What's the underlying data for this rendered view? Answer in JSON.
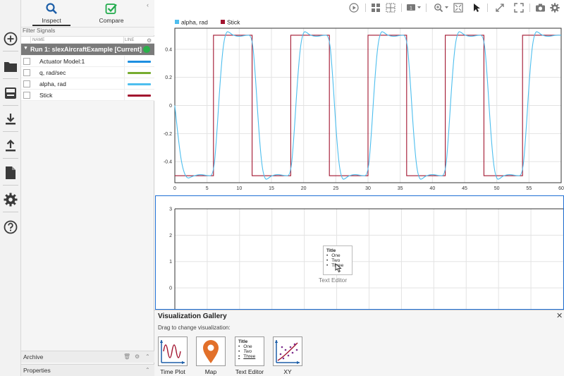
{
  "tabs": {
    "inspect": "Inspect",
    "compare": "Compare"
  },
  "filter_placeholder": "Filter Signals",
  "table_header": {
    "name": "NAME",
    "line": "LINE"
  },
  "run": {
    "label": "Run 1: slexAircraftExample [Current]"
  },
  "signals": [
    {
      "label": "Actuator Model:1",
      "color": "#1e8fe0"
    },
    {
      "label": "q, rad/sec",
      "color": "#77ac30"
    },
    {
      "label": "alpha, rad",
      "color": "#4dbeee"
    },
    {
      "label": "Stick",
      "color": "#a2142f"
    }
  ],
  "archive_label": "Archive",
  "properties_label": "Properties",
  "legend": [
    {
      "label": "alpha, rad",
      "color": "#4dbeee"
    },
    {
      "label": "Stick",
      "color": "#a2142f"
    }
  ],
  "icons": {
    "left_toolbar": [
      "new-icon",
      "open-folder-icon",
      "save-icon",
      "import-icon",
      "export-icon",
      "report-icon",
      "settings-icon",
      "help-icon"
    ],
    "top_toolbar": [
      "play-icon",
      "layout-icon",
      "subplot-icon",
      "zoom-icon",
      "fit-icon",
      "cursor-icon",
      "expand-icon",
      "fullscreen-icon",
      "camera-icon",
      "gear-icon"
    ]
  },
  "layout_badge": "1",
  "chart_data": [
    {
      "type": "line",
      "x_ticks": [
        "0",
        "5",
        "10",
        "15",
        "20",
        "25",
        "30",
        "35",
        "40",
        "45",
        "50",
        "55",
        "60"
      ],
      "y_ticks": [
        "-0.4",
        "-0.2",
        "0",
        "0.2",
        "0.4"
      ],
      "xlim": [
        0,
        60
      ],
      "ylim": [
        -0.55,
        0.55
      ],
      "grid": true,
      "legend_position": "top-left",
      "series": [
        {
          "name": "Stick",
          "color": "#a2142f",
          "x": [
            0,
            6,
            6,
            12,
            12,
            18,
            18,
            24,
            24,
            30,
            30,
            36,
            36,
            42,
            42,
            48,
            48,
            54,
            54,
            60
          ],
          "y": [
            -0.5,
            -0.5,
            0.5,
            0.5,
            -0.5,
            -0.5,
            0.5,
            0.5,
            -0.5,
            -0.5,
            0.5,
            0.5,
            -0.5,
            -0.5,
            0.5,
            0.5,
            -0.5,
            -0.5,
            0.5,
            0.5
          ]
        },
        {
          "name": "alpha, rad",
          "color": "#4dbeee",
          "x": [
            0,
            0.5,
            1,
            1.5,
            2,
            2.5,
            3,
            4,
            5,
            6,
            6.5,
            7,
            7.5,
            8,
            8.5,
            9,
            10,
            11,
            12,
            12.5,
            13,
            13.5,
            14,
            14.5,
            15,
            16,
            17,
            18,
            18.5,
            19,
            19.5,
            20,
            20.5,
            21,
            22,
            23,
            24,
            24.5,
            25,
            25.5,
            26,
            26.5,
            27,
            28,
            29,
            30,
            30.5,
            31,
            31.5,
            32,
            32.5,
            33,
            34,
            35,
            36,
            36.5,
            37,
            37.5,
            38,
            38.5,
            39,
            40,
            41,
            42,
            42.5,
            43,
            43.5,
            44,
            44.5,
            45,
            46,
            47,
            48,
            48.5,
            49,
            49.5,
            50,
            50.5,
            51,
            52,
            53,
            54,
            54.5,
            55,
            55.5,
            56,
            56.5,
            57,
            58,
            59,
            60
          ],
          "y": [
            0,
            -0.22,
            -0.4,
            -0.49,
            -0.52,
            -0.51,
            -0.5,
            -0.49,
            -0.5,
            -0.5,
            -0.22,
            0.15,
            0.43,
            0.53,
            0.52,
            0.5,
            0.49,
            0.5,
            0.5,
            0.22,
            -0.15,
            -0.43,
            -0.53,
            -0.52,
            -0.5,
            -0.49,
            -0.5,
            -0.5,
            -0.22,
            0.15,
            0.43,
            0.53,
            0.52,
            0.5,
            0.49,
            0.5,
            0.5,
            0.22,
            -0.15,
            -0.43,
            -0.53,
            -0.52,
            -0.5,
            -0.49,
            -0.5,
            -0.5,
            -0.22,
            0.15,
            0.43,
            0.53,
            0.52,
            0.5,
            0.49,
            0.5,
            0.5,
            0.22,
            -0.15,
            -0.43,
            -0.53,
            -0.52,
            -0.5,
            -0.49,
            -0.5,
            -0.5,
            -0.22,
            0.15,
            0.43,
            0.53,
            0.52,
            0.5,
            0.49,
            0.5,
            0.5,
            0.22,
            -0.15,
            -0.43,
            -0.53,
            -0.52,
            -0.5,
            -0.49,
            -0.5,
            -0.5,
            -0.22,
            0.15,
            0.43,
            0.53,
            0.52,
            0.5,
            0.49,
            0.5,
            0.5
          ]
        }
      ]
    },
    {
      "type": "line",
      "y_ticks": [
        "0",
        "1",
        "2",
        "3"
      ],
      "ylim": [
        -0.8,
        3
      ],
      "grid": true,
      "series": []
    }
  ],
  "drag_preview": {
    "title": "Title",
    "items": [
      "One",
      "Two",
      "Three"
    ],
    "caption": "Text Editor"
  },
  "gallery": {
    "title": "Visualization Gallery",
    "subtitle": "Drag to change visualization:",
    "items": [
      {
        "label": "Time Plot",
        "icon": "time-plot-icon"
      },
      {
        "label": "Map",
        "icon": "map-pin-icon"
      },
      {
        "label": "Text Editor",
        "icon": "text-editor-icon"
      },
      {
        "label": "XY",
        "icon": "xy-plot-icon"
      }
    ],
    "text_editor_title": "Title",
    "text_editor_items": [
      "One",
      "Two",
      "Three"
    ]
  }
}
